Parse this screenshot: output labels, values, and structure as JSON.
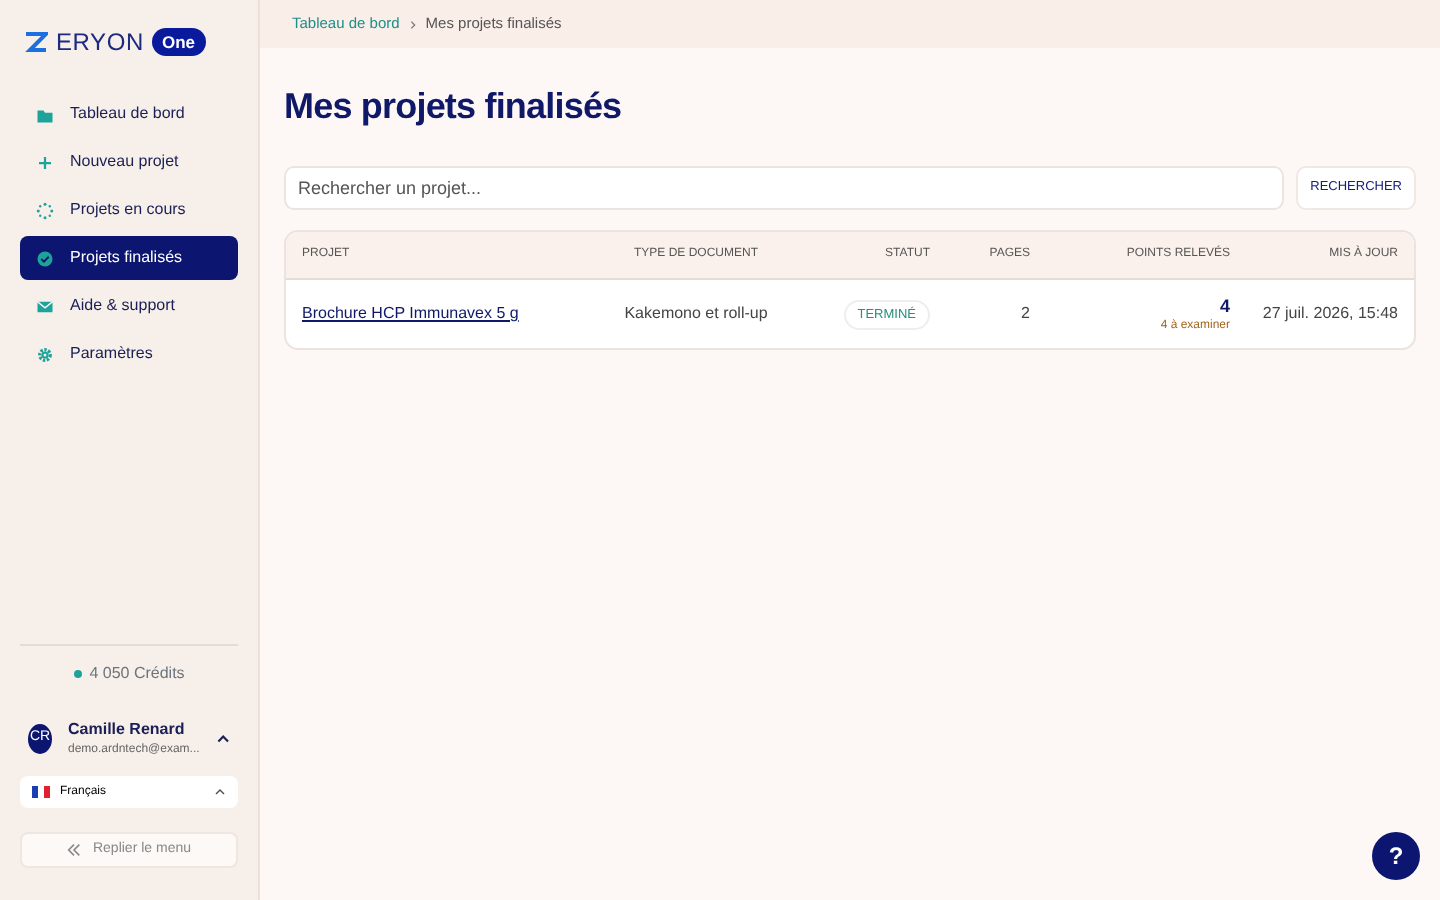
{
  "logo": {
    "wordmark": "ERYON",
    "badge": "One"
  },
  "sidebar": {
    "items": [
      {
        "label": "Tableau de bord",
        "selected": false
      },
      {
        "label": "Nouveau projet",
        "selected": false
      },
      {
        "label": "Projets en cours",
        "selected": false
      },
      {
        "label": "Projets finalisés",
        "selected": true
      },
      {
        "label": "Aide & support",
        "selected": false
      },
      {
        "label": "Paramètres",
        "selected": false
      }
    ],
    "credits": "4 050 Crédits",
    "user": {
      "initials": "CR",
      "name": "Camille Renard",
      "email": "demo.ardntech@exam..."
    },
    "language": "Français",
    "collapse": "Replier le menu"
  },
  "breadcrumb": [
    "Tableau de bord",
    "Mes projets finalisés"
  ],
  "title": "Mes projets finalisés",
  "search": {
    "placeholder": "Rechercher un projet...",
    "button": "RECHERCHER"
  },
  "table": {
    "columns": [
      "PROJET",
      "TYPE DE DOCUMENT",
      "STATUT",
      "PAGES",
      "POINTS RELEVÉS",
      "MIS À JOUR"
    ],
    "rows": [
      {
        "project": "Brochure HCP Immunavex 5 g",
        "type": "Kakemono et roll-up",
        "status": "TERMINÉ",
        "pages": "2",
        "points": "4",
        "to_review": "4 à examiner",
        "updated": "27 juil. 2026, 15:48"
      }
    ]
  },
  "help": "?"
}
